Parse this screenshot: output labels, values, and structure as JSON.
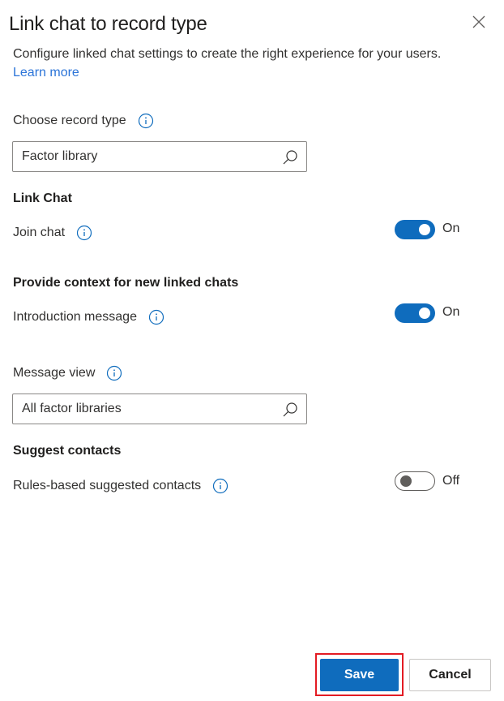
{
  "panel": {
    "title": "Link chat to record type",
    "description": "Configure linked chat settings to create the right experience for your users.",
    "learn_more": "Learn more"
  },
  "record_type": {
    "label": "Choose record type",
    "value": "Factor library"
  },
  "link_chat": {
    "heading": "Link Chat",
    "join_chat": {
      "label": "Join chat",
      "state": "On",
      "enabled": true
    }
  },
  "context": {
    "heading": "Provide context for new linked chats",
    "intro_message": {
      "label": "Introduction message",
      "state": "On",
      "enabled": true
    },
    "message_view": {
      "label": "Message view",
      "value": "All factor libraries"
    }
  },
  "suggest_contacts": {
    "heading": "Suggest contacts",
    "rules_based": {
      "label": "Rules-based suggested contacts",
      "state": "Off",
      "enabled": false
    }
  },
  "footer": {
    "save": "Save",
    "cancel": "Cancel"
  },
  "colors": {
    "accent": "#0f6cbd",
    "link": "#2b74d8",
    "highlight": "#e31b23"
  }
}
